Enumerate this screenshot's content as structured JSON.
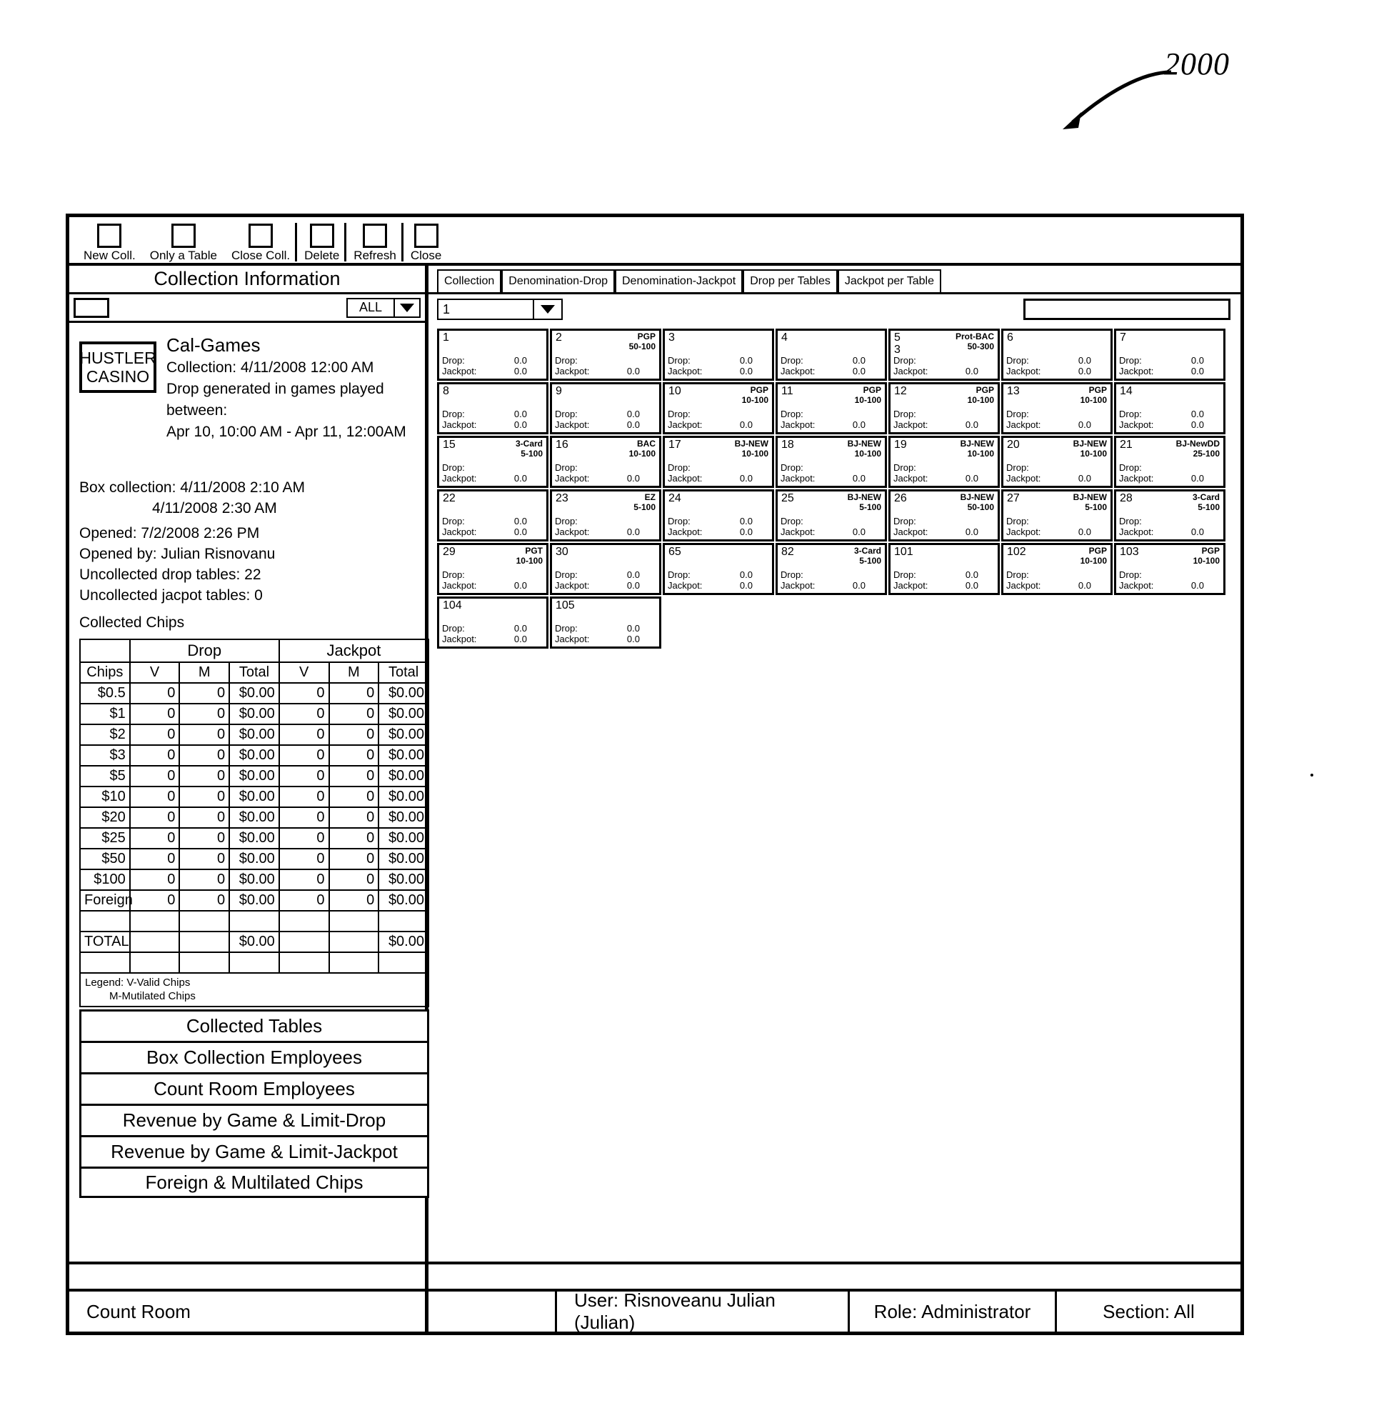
{
  "figure": {
    "number": "2000"
  },
  "toolbar": {
    "buttons": [
      {
        "label": "New Coll.",
        "sep": false
      },
      {
        "label": "Only a Table",
        "sep": false
      },
      {
        "label": "Close Coll.",
        "sep": true
      },
      {
        "label": "Delete",
        "sep": true
      },
      {
        "label": "Refresh",
        "sep": true
      },
      {
        "label": "Close",
        "sep": false
      }
    ]
  },
  "left": {
    "title": "Collection Information",
    "filter_input_value": "",
    "filter_select_value": "ALL",
    "casino_logo_line1": "HUSTLER",
    "casino_logo_line2": "CASINO",
    "collection_name": "Cal-Games",
    "collection_line": "Collection: 4/11/2008 12:00 AM",
    "drop_generated_line": "Drop generated in games played between:",
    "drop_generated_range": "Apr 10, 10:00 AM - Apr 11, 12:00AM",
    "box_collection_label": "Box collection: 4/11/2008 2:10 AM",
    "box_collection_second": "4/11/2008 2:30 AM",
    "opened": "Opened: 7/2/2008 2:26 PM",
    "opened_by": "Opened by: Julian Risnovanu",
    "uncollected_drop": "Uncollected drop tables: 22",
    "uncollected_jackpot": "Uncollected jacpot tables: 0",
    "collected_chips_label": "Collected Chips",
    "chips_table": {
      "group_headers": [
        "Drop",
        "Jackpot"
      ],
      "columns": [
        "Chips",
        "V",
        "M",
        "Total",
        "V",
        "M",
        "Total"
      ],
      "rows": [
        {
          "chips": "$0.5",
          "dv": "0",
          "dm": "0",
          "dtotal": "$0.00",
          "jv": "0",
          "jm": "0",
          "jtotal": "$0.00"
        },
        {
          "chips": "$1",
          "dv": "0",
          "dm": "0",
          "dtotal": "$0.00",
          "jv": "0",
          "jm": "0",
          "jtotal": "$0.00"
        },
        {
          "chips": "$2",
          "dv": "0",
          "dm": "0",
          "dtotal": "$0.00",
          "jv": "0",
          "jm": "0",
          "jtotal": "$0.00"
        },
        {
          "chips": "$3",
          "dv": "0",
          "dm": "0",
          "dtotal": "$0.00",
          "jv": "0",
          "jm": "0",
          "jtotal": "$0.00"
        },
        {
          "chips": "$5",
          "dv": "0",
          "dm": "0",
          "dtotal": "$0.00",
          "jv": "0",
          "jm": "0",
          "jtotal": "$0.00"
        },
        {
          "chips": "$10",
          "dv": "0",
          "dm": "0",
          "dtotal": "$0.00",
          "jv": "0",
          "jm": "0",
          "jtotal": "$0.00"
        },
        {
          "chips": "$20",
          "dv": "0",
          "dm": "0",
          "dtotal": "$0.00",
          "jv": "0",
          "jm": "0",
          "jtotal": "$0.00"
        },
        {
          "chips": "$25",
          "dv": "0",
          "dm": "0",
          "dtotal": "$0.00",
          "jv": "0",
          "jm": "0",
          "jtotal": "$0.00"
        },
        {
          "chips": "$50",
          "dv": "0",
          "dm": "0",
          "dtotal": "$0.00",
          "jv": "0",
          "jm": "0",
          "jtotal": "$0.00"
        },
        {
          "chips": "$100",
          "dv": "0",
          "dm": "0",
          "dtotal": "$0.00",
          "jv": "0",
          "jm": "0",
          "jtotal": "$0.00"
        },
        {
          "chips": "Foreign",
          "dv": "0",
          "dm": "0",
          "dtotal": "$0.00",
          "jv": "0",
          "jm": "0",
          "jtotal": "$0.00"
        }
      ],
      "total_row": {
        "chips": "TOTAL",
        "dv": "",
        "dm": "",
        "dtotal": "$0.00",
        "jv": "",
        "jm": "",
        "jtotal": "$0.00"
      }
    },
    "legend_line1": "Legend: V-Valid Chips",
    "legend_line2": "M-Mutilated Chips",
    "section_buttons": [
      "Collected Tables",
      "Box Collection Employees",
      "Count Room Employees",
      "Revenue by Game & Limit-Drop",
      "Revenue by Game & Limit-Jackpot",
      "Foreign & Multilated Chips"
    ]
  },
  "right": {
    "tabs": [
      {
        "label": "Collection",
        "active": true
      },
      {
        "label": "Denomination-Drop",
        "active": false
      },
      {
        "label": "Denomination-Jackpot",
        "active": false
      },
      {
        "label": "Drop per Tables",
        "active": false
      },
      {
        "label": "Jackpot per Table",
        "active": false
      }
    ],
    "table_number_value": "1",
    "search_input_value": "",
    "card_labels": {
      "drop": "Drop:",
      "jackpot": "Jackpot:"
    },
    "cards": [
      {
        "num": "1",
        "sub": "",
        "game": "",
        "limit": "",
        "drop": "0.0",
        "jackpot": "0.0"
      },
      {
        "num": "2",
        "sub": "",
        "game": "PGP",
        "limit": "50-100",
        "drop": "",
        "jackpot": "0.0"
      },
      {
        "num": "3",
        "sub": "",
        "game": "",
        "limit": "",
        "drop": "0.0",
        "jackpot": "0.0"
      },
      {
        "num": "4",
        "sub": "",
        "game": "",
        "limit": "",
        "drop": "0.0",
        "jackpot": "0.0"
      },
      {
        "num": "5",
        "sub": "3",
        "game": "Prot-BAC",
        "limit": "50-300",
        "drop": "",
        "jackpot": "0.0"
      },
      {
        "num": "6",
        "sub": "",
        "game": "",
        "limit": "",
        "drop": "0.0",
        "jackpot": "0.0"
      },
      {
        "num": "7",
        "sub": "",
        "game": "",
        "limit": "",
        "drop": "0.0",
        "jackpot": "0.0"
      },
      {
        "num": "8",
        "sub": "",
        "game": "",
        "limit": "",
        "drop": "0.0",
        "jackpot": "0.0"
      },
      {
        "num": "9",
        "sub": "",
        "game": "",
        "limit": "",
        "drop": "0.0",
        "jackpot": "0.0"
      },
      {
        "num": "10",
        "sub": "",
        "game": "PGP",
        "limit": "10-100",
        "drop": "",
        "jackpot": "0.0"
      },
      {
        "num": "11",
        "sub": "",
        "game": "PGP",
        "limit": "10-100",
        "drop": "",
        "jackpot": "0.0"
      },
      {
        "num": "12",
        "sub": "",
        "game": "PGP",
        "limit": "10-100",
        "drop": "",
        "jackpot": "0.0"
      },
      {
        "num": "13",
        "sub": "",
        "game": "PGP",
        "limit": "10-100",
        "drop": "",
        "jackpot": "0.0"
      },
      {
        "num": "14",
        "sub": "",
        "game": "",
        "limit": "",
        "drop": "0.0",
        "jackpot": "0.0"
      },
      {
        "num": "15",
        "sub": "",
        "game": "3-Card",
        "limit": "5-100",
        "drop": "",
        "jackpot": "0.0"
      },
      {
        "num": "16",
        "sub": "",
        "game": "BAC",
        "limit": "10-100",
        "drop": "",
        "jackpot": "0.0"
      },
      {
        "num": "17",
        "sub": "",
        "game": "BJ-NEW",
        "limit": "10-100",
        "drop": "",
        "jackpot": "0.0"
      },
      {
        "num": "18",
        "sub": "",
        "game": "BJ-NEW",
        "limit": "10-100",
        "drop": "",
        "jackpot": "0.0"
      },
      {
        "num": "19",
        "sub": "",
        "game": "BJ-NEW",
        "limit": "10-100",
        "drop": "",
        "jackpot": "0.0"
      },
      {
        "num": "20",
        "sub": "",
        "game": "BJ-NEW",
        "limit": "10-100",
        "drop": "",
        "jackpot": "0.0"
      },
      {
        "num": "21",
        "sub": "",
        "game": "BJ-NewDD",
        "limit": "25-100",
        "drop": "",
        "jackpot": "0.0"
      },
      {
        "num": "22",
        "sub": "",
        "game": "",
        "limit": "",
        "drop": "0.0",
        "jackpot": "0.0"
      },
      {
        "num": "23",
        "sub": "",
        "game": "EZ",
        "limit": "5-100",
        "drop": "",
        "jackpot": "0.0"
      },
      {
        "num": "24",
        "sub": "",
        "game": "",
        "limit": "",
        "drop": "0.0",
        "jackpot": "0.0"
      },
      {
        "num": "25",
        "sub": "",
        "game": "BJ-NEW",
        "limit": "5-100",
        "drop": "",
        "jackpot": "0.0"
      },
      {
        "num": "26",
        "sub": "",
        "game": "BJ-NEW",
        "limit": "50-100",
        "drop": "",
        "jackpot": "0.0"
      },
      {
        "num": "27",
        "sub": "",
        "game": "BJ-NEW",
        "limit": "5-100",
        "drop": "",
        "jackpot": "0.0"
      },
      {
        "num": "28",
        "sub": "",
        "game": "3-Card",
        "limit": "5-100",
        "drop": "",
        "jackpot": "0.0"
      },
      {
        "num": "29",
        "sub": "",
        "game": "PGT",
        "limit": "10-100",
        "drop": "",
        "jackpot": "0.0"
      },
      {
        "num": "30",
        "sub": "",
        "game": "",
        "limit": "",
        "drop": "0.0",
        "jackpot": "0.0"
      },
      {
        "num": "65",
        "sub": "",
        "game": "",
        "limit": "",
        "drop": "0.0",
        "jackpot": "0.0"
      },
      {
        "num": "82",
        "sub": "",
        "game": "3-Card",
        "limit": "5-100",
        "drop": "",
        "jackpot": "0.0"
      },
      {
        "num": "101",
        "sub": "",
        "game": "",
        "limit": "",
        "drop": "0.0",
        "jackpot": "0.0"
      },
      {
        "num": "102",
        "sub": "",
        "game": "PGP",
        "limit": "10-100",
        "drop": "",
        "jackpot": "0.0"
      },
      {
        "num": "103",
        "sub": "",
        "game": "PGP",
        "limit": "10-100",
        "drop": "",
        "jackpot": "0.0"
      },
      {
        "num": "104",
        "sub": "",
        "game": "",
        "limit": "",
        "drop": "0.0",
        "jackpot": "0.0"
      },
      {
        "num": "105",
        "sub": "",
        "game": "",
        "limit": "",
        "drop": "0.0",
        "jackpot": "0.0"
      }
    ]
  },
  "status": {
    "left": "Count Room",
    "user": "User: Risnoveanu Julian (Julian)",
    "role": "Role: Administrator",
    "section": "Section: All"
  }
}
